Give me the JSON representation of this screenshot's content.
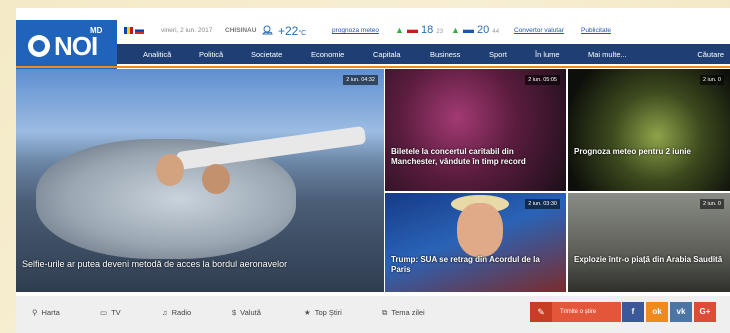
{
  "brand": {
    "logo": "NOI",
    "suffix": "MD"
  },
  "infobar": {
    "date": "vineri, 2 iun. 2017",
    "city": "CHISINAU",
    "weather_icon": "sun-cloud-icon",
    "temp": "+22",
    "temp_unit": "°C",
    "forecast_link": "prognoza meteo",
    "usd_value": "18",
    "usd_change": "23",
    "eur_value": "20",
    "eur_change": "44",
    "converter": "Convertor valutar",
    "publicity": "Publicitate"
  },
  "nav": {
    "items": [
      "Analitică",
      "Politică",
      "Societate",
      "Economie",
      "Capitala",
      "Business",
      "Sport",
      "În lume",
      "Mai multe..."
    ],
    "search": "Căutare"
  },
  "news": {
    "main": {
      "time": "2 iun. 04:32",
      "title": "Selfie-urile ar putea deveni metodă de acces la bordul aeronavelor"
    },
    "t1": {
      "time": "2 iun. 05:05",
      "title": "Biletele la concertul caritabil din Manchester, vândute în timp record"
    },
    "t2": {
      "time": "2 iun. 0",
      "title": "Prognoza meteo pentru 2 iunie"
    },
    "t3": {
      "time": "2 iun. 03:30",
      "title": "Trump: SUA se retrag din Acordul de la Paris"
    },
    "t4": {
      "time": "2 iun. 0",
      "title": "Explozie într-o piață din Arabia Saudită"
    }
  },
  "bottom": {
    "items": [
      "Harta",
      "TV",
      "Radio",
      "Valută",
      "Top Știri",
      "Tema zilei"
    ],
    "send": "Trimite o știre",
    "social": [
      "f",
      "ok",
      "vk",
      "G+"
    ]
  },
  "colors": {
    "brand_blue": "#1f63bb",
    "nav": "#1f3f74",
    "accent": "#f08a1a"
  }
}
